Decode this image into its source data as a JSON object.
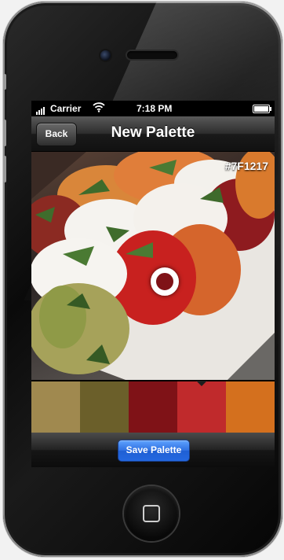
{
  "status_bar": {
    "carrier": "Carrier",
    "time": "7:18 PM"
  },
  "nav_bar": {
    "back_label": "Back",
    "title": "New Palette"
  },
  "photo": {
    "selected_hex": "#7F1217",
    "subject": "caprese salad photo"
  },
  "palette": {
    "swatches": [
      {
        "color": "#A0894F",
        "selected": false
      },
      {
        "color": "#6B5F2A",
        "selected": false
      },
      {
        "color": "#7F1217",
        "selected": false
      },
      {
        "color": "#C02A2C",
        "selected": true
      },
      {
        "color": "#D4701E",
        "selected": false
      }
    ]
  },
  "toolbar": {
    "save_label": "Save Palette"
  },
  "icons": {
    "signal": "signal-bars-icon",
    "wifi": "wifi-icon",
    "battery": "battery-icon",
    "home": "home-button-icon"
  }
}
